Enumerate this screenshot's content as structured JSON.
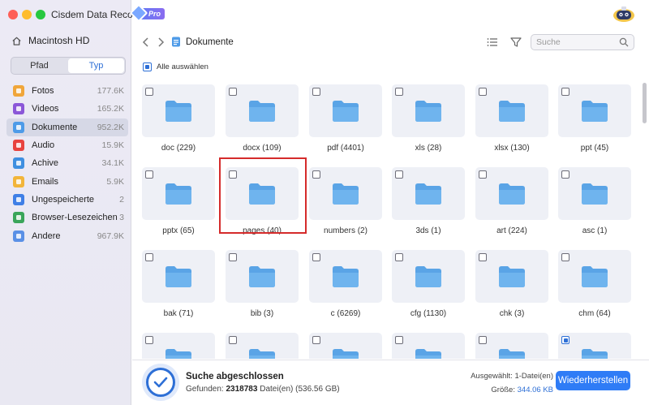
{
  "app": {
    "title": "Cisdem Data Recovery",
    "badge": "Pro"
  },
  "colors": {
    "accent": "#2d6fd6",
    "button": "#2f7cf6",
    "folder": "#5aa4e6",
    "highlight": "#d52b2b"
  },
  "sidebar": {
    "disk_label": "Macintosh HD",
    "tabs": [
      {
        "label": "Pfad",
        "active": false
      },
      {
        "label": "Typ",
        "active": true
      }
    ],
    "categories": [
      {
        "name": "Fotos",
        "count": "177.6K",
        "icon": "photo-icon",
        "color": "#f0a63a",
        "active": false
      },
      {
        "name": "Videos",
        "count": "165.2K",
        "icon": "video-icon",
        "color": "#8b57d8",
        "active": false
      },
      {
        "name": "Dokumente",
        "count": "952.2K",
        "icon": "document-icon",
        "color": "#4e9be8",
        "active": true
      },
      {
        "name": "Audio",
        "count": "15.9K",
        "icon": "audio-icon",
        "color": "#e8433f",
        "active": false
      },
      {
        "name": "Achive",
        "count": "34.1K",
        "icon": "archive-icon",
        "color": "#3f8fe0",
        "active": false
      },
      {
        "name": "Emails",
        "count": "5.9K",
        "icon": "email-icon",
        "color": "#f2b53a",
        "active": false
      },
      {
        "name": "Ungespeicherte",
        "count": "2",
        "icon": "unsaved-icon",
        "color": "#3f7fe6",
        "active": false
      },
      {
        "name": "Browser-Lesezeichen",
        "count": "3",
        "icon": "bookmark-icon",
        "color": "#3aa55a",
        "active": false
      },
      {
        "name": "Andere",
        "count": "967.9K",
        "icon": "other-icon",
        "color": "#5a90e6",
        "active": false
      }
    ]
  },
  "toolbar": {
    "breadcrumb": "Dokumente",
    "search_placeholder": "Suche",
    "select_all": "Alle auswählen"
  },
  "grid": {
    "highlighted_index": 7,
    "items": [
      {
        "label": "doc (229)",
        "checked": false
      },
      {
        "label": "docx (109)",
        "checked": false
      },
      {
        "label": "pdf (4401)",
        "checked": false
      },
      {
        "label": "xls (28)",
        "checked": false
      },
      {
        "label": "xlsx (130)",
        "checked": false
      },
      {
        "label": "ppt (45)",
        "checked": false
      },
      {
        "label": "pptx (65)",
        "checked": false
      },
      {
        "label": "pages (40)",
        "checked": false
      },
      {
        "label": "numbers (2)",
        "checked": false
      },
      {
        "label": "3ds (1)",
        "checked": false
      },
      {
        "label": "art (224)",
        "checked": false
      },
      {
        "label": "asc (1)",
        "checked": false
      },
      {
        "label": "bak (71)",
        "checked": false
      },
      {
        "label": "bib (3)",
        "checked": false
      },
      {
        "label": "c (6269)",
        "checked": false
      },
      {
        "label": "cfg (1130)",
        "checked": false
      },
      {
        "label": "chk (3)",
        "checked": false
      },
      {
        "label": "chm (64)",
        "checked": false
      },
      {
        "label": "",
        "checked": false
      },
      {
        "label": "",
        "checked": false
      },
      {
        "label": "",
        "checked": false
      },
      {
        "label": "",
        "checked": false
      },
      {
        "label": "",
        "checked": false
      },
      {
        "label": "",
        "checked": true
      }
    ]
  },
  "footer": {
    "status_title": "Suche abgeschlossen",
    "found_prefix": "Gefunden:",
    "found_count": "2318783",
    "found_suffix": "Datei(en) (536.56 GB)",
    "selected_label": "Ausgewählt: 1-Datei(en)",
    "size_label": "Größe:",
    "size_value": "344.06 KB",
    "recover_button": "Wiederherstellen"
  }
}
